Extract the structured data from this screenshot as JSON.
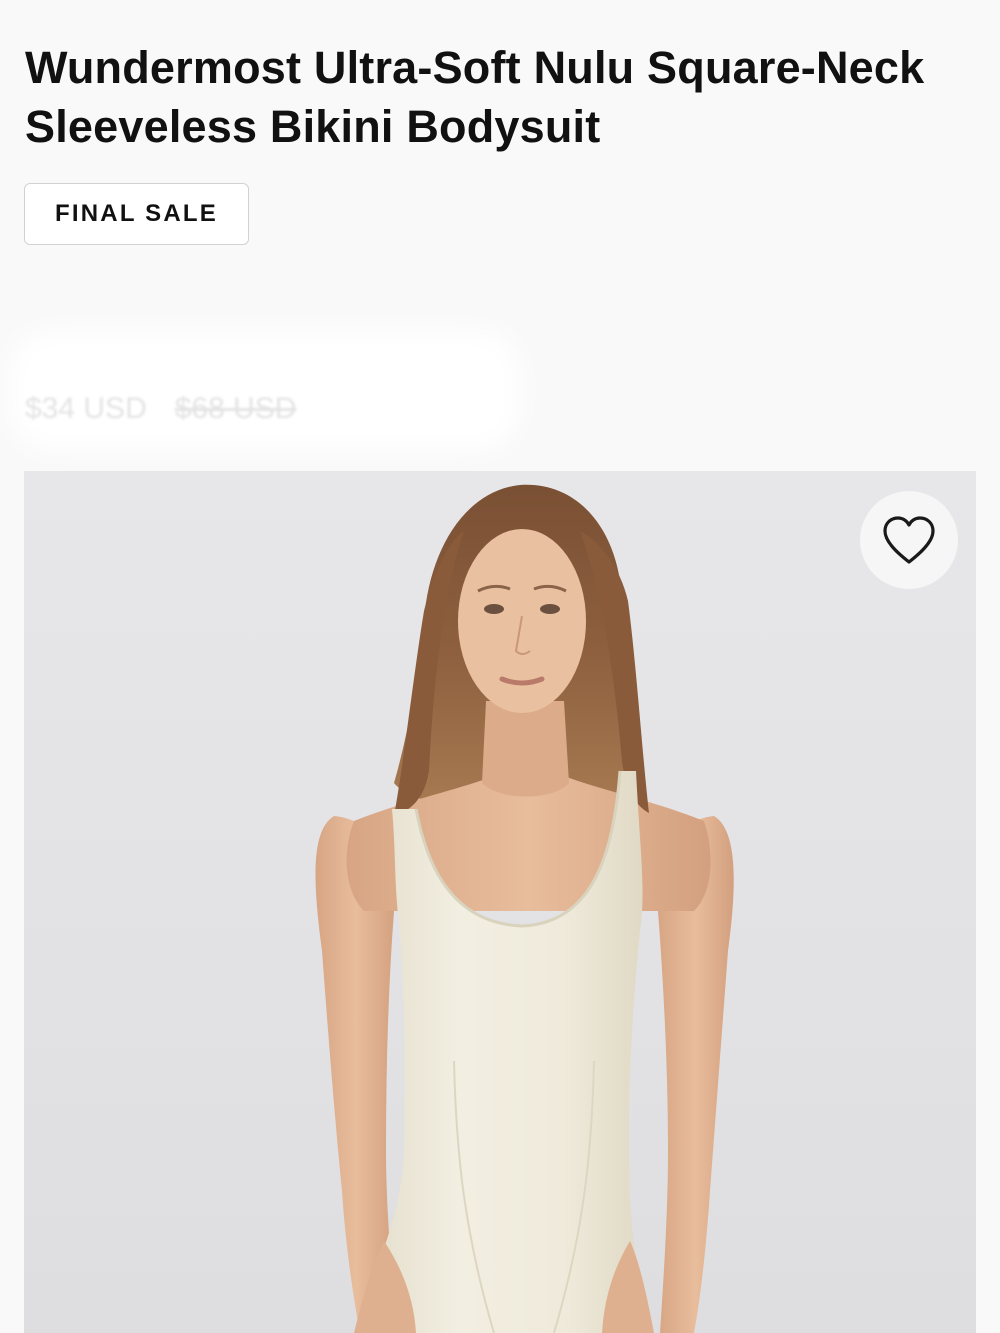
{
  "product": {
    "title": "Wundermost Ultra-Soft Nulu Square-Neck Sleeveless Bikini Bodysuit",
    "badge": "FINAL SALE",
    "price_sale": "$34 USD",
    "price_original": "$68 USD"
  },
  "gallery": {
    "image_alt": "Model wearing an ivory square-neck sleeveless bodysuit",
    "wishlist_icon": "heart-outline-icon"
  },
  "colors": {
    "background": "#f9f9f9",
    "text": "#111111",
    "badge_border": "#d2d2d2",
    "gallery_background": "#e4e4e6",
    "garment": "#efeadb"
  }
}
